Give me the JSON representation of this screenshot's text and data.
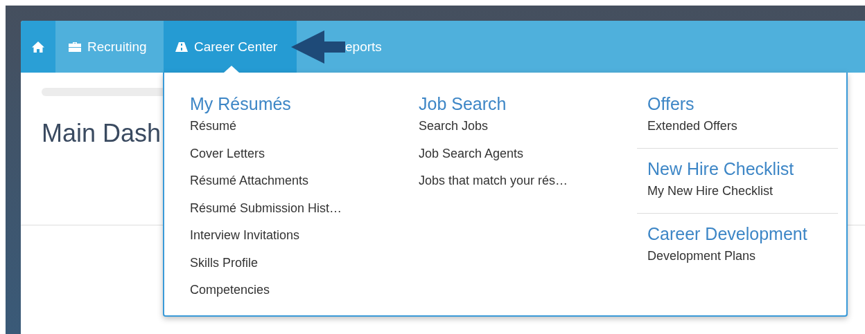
{
  "nav": [
    {
      "kind": "home",
      "selected": false
    },
    {
      "kind": "briefcase",
      "label": "Recruiting",
      "selected": false
    },
    {
      "kind": "road",
      "label": "Career Center",
      "selected": true
    },
    {
      "kind": "plain",
      "label": "eports",
      "selected": false
    }
  ],
  "page": {
    "title": "Main Dash"
  },
  "dropdown": {
    "columns": [
      [
        {
          "heading": "My Résumés",
          "items": [
            "Résumé",
            "Cover Letters",
            "Résumé Attachments",
            "Résumé Submission Hist…",
            "Interview Invitations",
            "Skills Profile",
            "Competencies"
          ]
        }
      ],
      [
        {
          "heading": "Job Search",
          "items": [
            "Search Jobs",
            "Job Search Agents",
            "Jobs that match your rés…"
          ]
        }
      ],
      [
        {
          "heading": "Offers",
          "items": [
            "Extended Offers"
          ]
        },
        {
          "heading": "New Hire Checklist",
          "items": [
            "My New Hire Checklist"
          ]
        },
        {
          "heading": "Career Development",
          "items": [
            "Development Plans"
          ]
        }
      ]
    ]
  }
}
